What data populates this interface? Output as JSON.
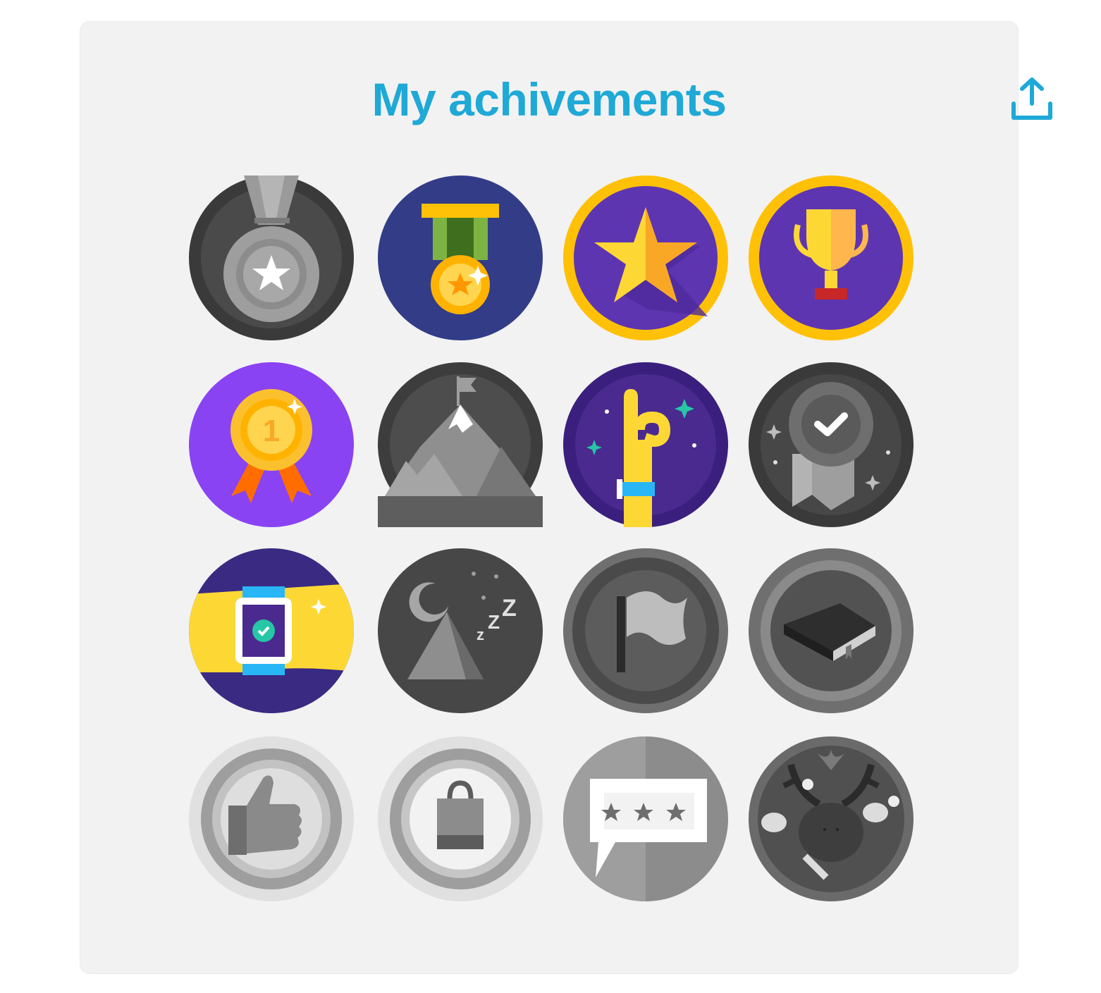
{
  "header": {
    "title": "My achivements",
    "share_icon": "share-upload-icon"
  },
  "colors": {
    "accent": "#1fa9d6",
    "card_background": "#f2f2f2"
  },
  "badges": [
    {
      "icon": "silver-medal-star-icon",
      "state": "locked"
    },
    {
      "icon": "gold-medal-ribbon-icon",
      "state": "earned"
    },
    {
      "icon": "gold-star-icon",
      "state": "earned"
    },
    {
      "icon": "trophy-cup-icon",
      "state": "earned"
    },
    {
      "icon": "first-place-rosette-icon",
      "state": "earned"
    },
    {
      "icon": "mountain-summit-flag-icon",
      "state": "locked"
    },
    {
      "icon": "hand-raised-wristband-icon",
      "state": "earned"
    },
    {
      "icon": "checkmark-rosette-icon",
      "state": "locked"
    },
    {
      "icon": "smartwatch-check-icon",
      "state": "earned"
    },
    {
      "icon": "tent-sleep-moon-icon",
      "state": "locked"
    },
    {
      "icon": "flag-icon",
      "state": "locked"
    },
    {
      "icon": "book-icon",
      "state": "locked"
    },
    {
      "icon": "thumbs-up-seal-icon",
      "state": "locked"
    },
    {
      "icon": "shopping-bag-seal-icon",
      "state": "locked"
    },
    {
      "icon": "rating-stars-speech-icon",
      "state": "locked"
    },
    {
      "icon": "reindeer-holiday-icon",
      "state": "locked"
    }
  ]
}
